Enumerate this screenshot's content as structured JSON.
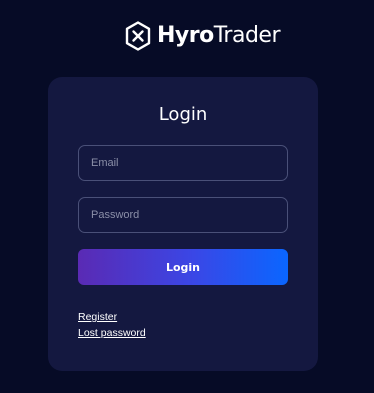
{
  "brand": {
    "name_bold": "Hyro",
    "name_light": "Trader",
    "logo_icon": "hexagon-x-logo-icon"
  },
  "login": {
    "title": "Login",
    "email_placeholder": "Email",
    "password_placeholder": "Password",
    "submit_label": "Login"
  },
  "links": {
    "register": "Register",
    "lost_password": "Lost password"
  },
  "colors": {
    "background": "#060b26",
    "card": "#141840",
    "button_gradient_start": "#5a2ab4",
    "button_gradient_end": "#0a66ff"
  }
}
